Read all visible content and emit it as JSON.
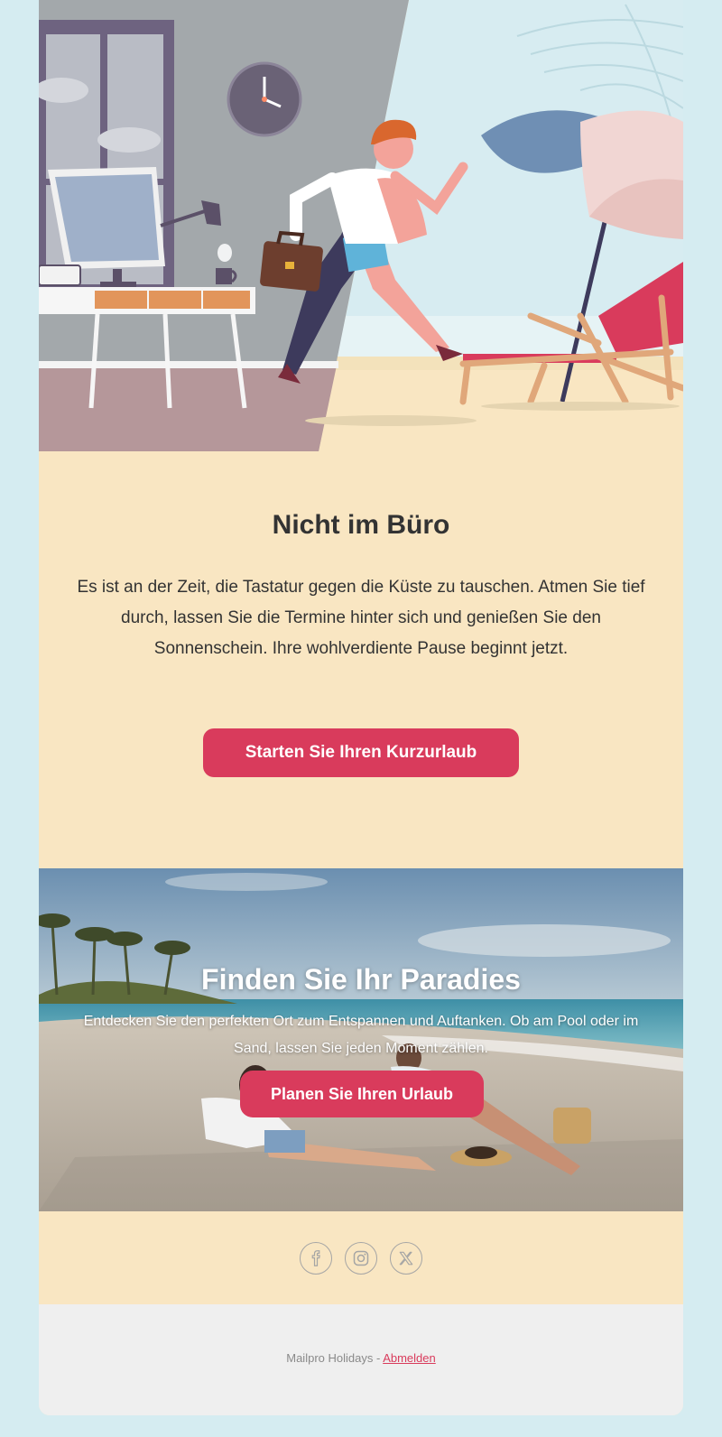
{
  "hero": {
    "illustration_icon": "office-to-beach-illustration"
  },
  "content": {
    "title": "Nicht im Büro",
    "text": "Es ist an der Zeit, die Tastatur gegen die Küste zu tauschen. Atmen Sie tief durch, lassen Sie die Termine hinter sich und genießen Sie den Sonnenschein. Ihre wohlverdiente Pause beginnt jetzt.",
    "button_label": "Starten Sie Ihren Kurzurlaub"
  },
  "beach_section": {
    "image_icon": "beach-couple-photo",
    "title": "Finden Sie Ihr Paradies",
    "text": "Entdecken Sie den perfekten Ort zum Entspannen und Auftanken. Ob am Pool oder im Sand, lassen Sie jeden Moment zählen.",
    "button_label": "Planen Sie Ihren Urlaub"
  },
  "social": {
    "icons": [
      "facebook-icon",
      "instagram-icon",
      "x-icon"
    ]
  },
  "footer": {
    "company": "Mailpro Holidays - ",
    "unsubscribe_label": "Abmelden"
  },
  "colors": {
    "page_background": "#d5ecf1",
    "card_background": "#f9e6c2",
    "accent": "#d93b5c",
    "footer_background": "#efefef",
    "text": "#333333"
  }
}
